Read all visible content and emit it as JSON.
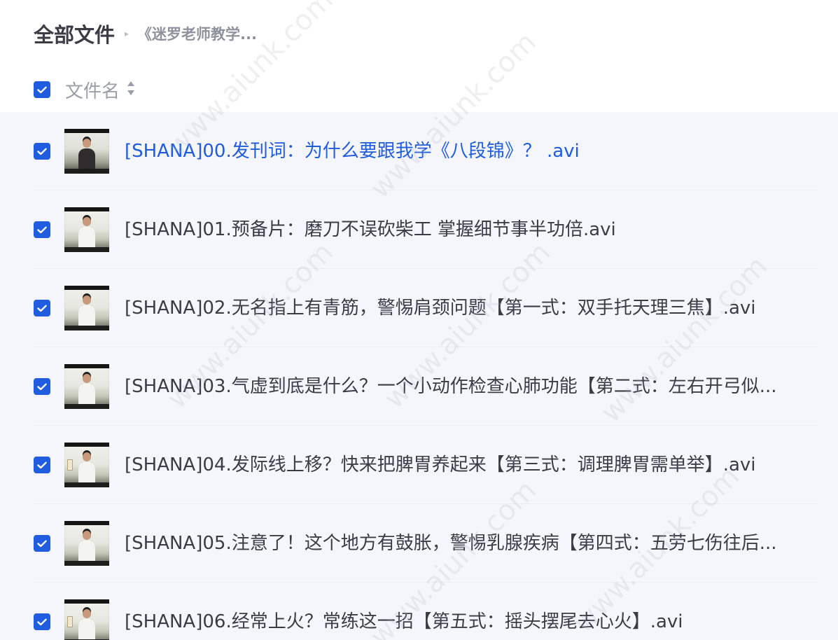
{
  "breadcrumb": {
    "root": "全部文件",
    "separator": "▸",
    "current": "《迷罗老师教学..."
  },
  "list_header": {
    "column_name": "文件名",
    "all_checked": true
  },
  "files": [
    {
      "name": "[SHANA]00.发刊词：为什么要跟我学《八段锦》？ .avi",
      "checked": true,
      "highlighted": true
    },
    {
      "name": "[SHANA]01.预备片：磨刀不误砍柴工 掌握细节事半功倍.avi",
      "checked": true
    },
    {
      "name": "[SHANA]02.无名指上有青筋，警惕肩颈问题【第一式：双手托天理三焦】.avi",
      "checked": true
    },
    {
      "name": "[SHANA]03.气虚到底是什么？一个小动作检查心肺功能【第二式：左右开弓似...",
      "checked": true
    },
    {
      "name": "[SHANA]04.发际线上移？快来把脾胃养起来【第三式：调理脾胃需单举】.avi",
      "checked": true
    },
    {
      "name": "[SHANA]05.注意了！这个地方有鼓胀，警惕乳腺疾病【第四式：五劳七伤往后...",
      "checked": true
    },
    {
      "name": "[SHANA]06.经常上火？常练这一招【第五式：摇头摆尾去心火】.avi",
      "checked": true
    }
  ],
  "watermark": "www.aiunk.com",
  "colors": {
    "accent": "#1f5cde",
    "text": "#3c3c46",
    "muted": "#9a9ea8",
    "row_background": "#f5f6fc"
  }
}
